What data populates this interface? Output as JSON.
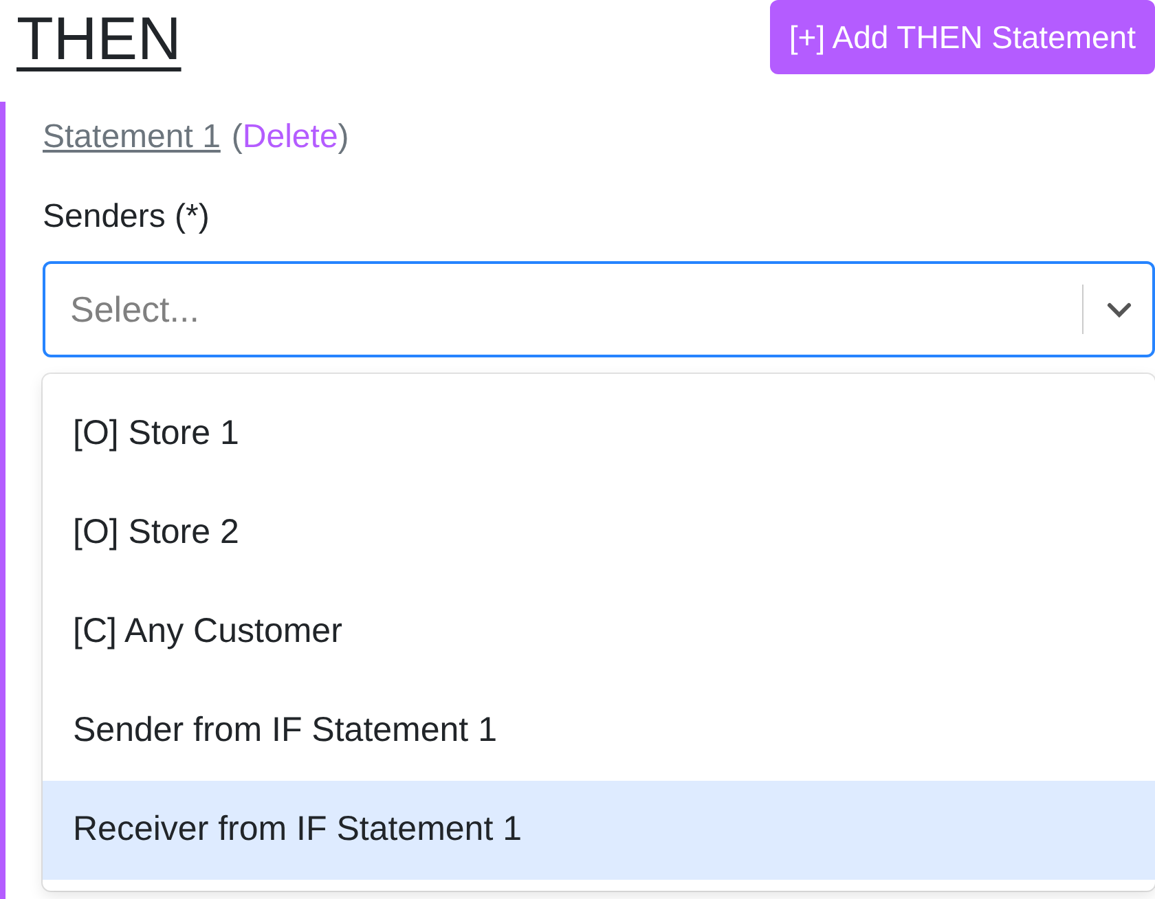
{
  "heading": "THEN",
  "add_button": "[+] Add THEN Statement",
  "statement": {
    "title": "Statement 1",
    "open_paren": "(",
    "delete_link": "Delete",
    "close_paren": ")"
  },
  "senders": {
    "label": "Senders (*)",
    "placeholder": "Select...",
    "focused": true,
    "expanded": true,
    "options": [
      {
        "label": "[O] Store 1",
        "selected": false
      },
      {
        "label": "[O] Store 2",
        "selected": false
      },
      {
        "label": "[C] Any Customer",
        "selected": false
      },
      {
        "label": "Sender from IF Statement 1",
        "selected": false
      },
      {
        "label": "Receiver from IF Statement 1",
        "selected": true
      }
    ]
  }
}
